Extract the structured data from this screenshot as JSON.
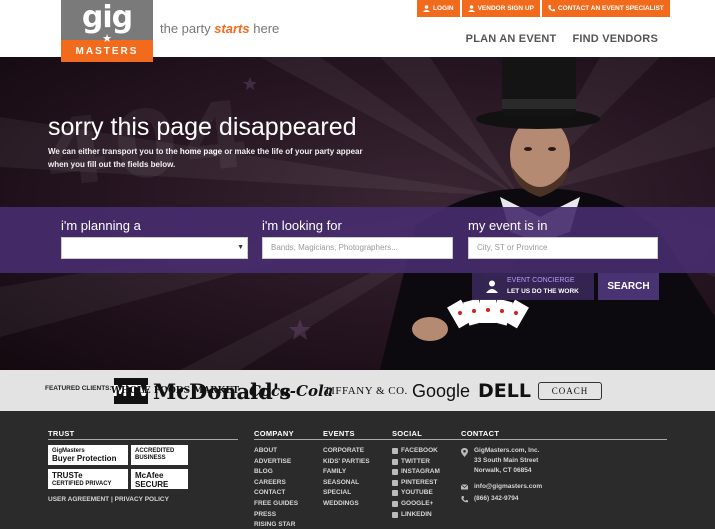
{
  "header": {
    "logo_top": "gig",
    "logo_bottom": "MASTERS",
    "tagline_pre": "the party ",
    "tagline_em": "starts",
    "tagline_post": " here",
    "top_links": [
      {
        "label": "LOGIN",
        "icon": "user-icon"
      },
      {
        "label": "VENDOR SIGN UP",
        "icon": "user-icon"
      },
      {
        "label": "CONTACT AN EVENT SPECIALIST",
        "icon": "phone-icon"
      }
    ],
    "nav": [
      "PLAN AN EVENT",
      "FIND VENDORS"
    ]
  },
  "hero": {
    "title": "sorry this page disappeared",
    "sub_pre": "We can either transport you to the ",
    "sub_link": "home page",
    "sub_post": " or make the life of your party appear when you fill out the fields below.",
    "search": {
      "planning_label": "i'm planning a",
      "planning_value": "",
      "looking_label": "i'm looking for",
      "looking_placeholder": "Bands, Magicians, Photographers...",
      "event_label": "my event is in",
      "event_placeholder": "City, ST or Province",
      "concierge_line1": "EVENT CONCIERGE",
      "concierge_line2": "LET US DO THE WORK",
      "search_button": "SEARCH"
    }
  },
  "clients": {
    "label": "FEATURED CLIENTS:",
    "logos": [
      "MTV",
      "WHOLE FOODS MARKET",
      "McDonald's",
      "Coca-Cola",
      "TIFFANY & CO.",
      "Google",
      "DELL",
      "COACH"
    ]
  },
  "footer": {
    "trust_heading": "TRUST",
    "badges": {
      "gigmasters_1": "GigMasters",
      "gigmasters_2": "Buyer Protection",
      "bbb_1": "ACCREDITED",
      "bbb_2": "BUSINESS",
      "truste_1": "TRUSTe",
      "truste_2": "CERTIFIED PRIVACY",
      "mcafee_1": "McAfee",
      "mcafee_2": "SECURE"
    },
    "legal_links": [
      "USER AGREEMENT",
      "|",
      "PRIVACY POLICY"
    ],
    "company_heading": "COMPANY",
    "company_links": [
      "ABOUT",
      "ADVERTISE",
      "BLOG",
      "CAREERS",
      "CONTACT",
      "FREE GUIDES",
      "PRESS",
      "RISING STAR"
    ],
    "events_heading": "EVENTS",
    "events_links": [
      "CORPORATE",
      "KIDS' PARTIES",
      "FAMILY",
      "SEASONAL",
      "SPECIAL",
      "WEDDINGS"
    ],
    "social_heading": "SOCIAL",
    "social_links": [
      "FACEBOOK",
      "TWITTER",
      "INSTAGRAM",
      "PINTEREST",
      "YOUTUBE",
      "GOOGLE+",
      "LINKEDIN"
    ],
    "contact_heading": "CONTACT",
    "address": [
      "GigMasters.com, Inc.",
      "33 South Main Street",
      "Norwalk, CT 06854"
    ],
    "email": "info@gigmasters.com",
    "phone": "(866) 342-9794"
  },
  "colors": {
    "brand_orange": "#f26b1d",
    "logo_grey": "#7a7a7a",
    "band_purple": "#462d6e",
    "footer_bg": "#2b2b2b"
  }
}
